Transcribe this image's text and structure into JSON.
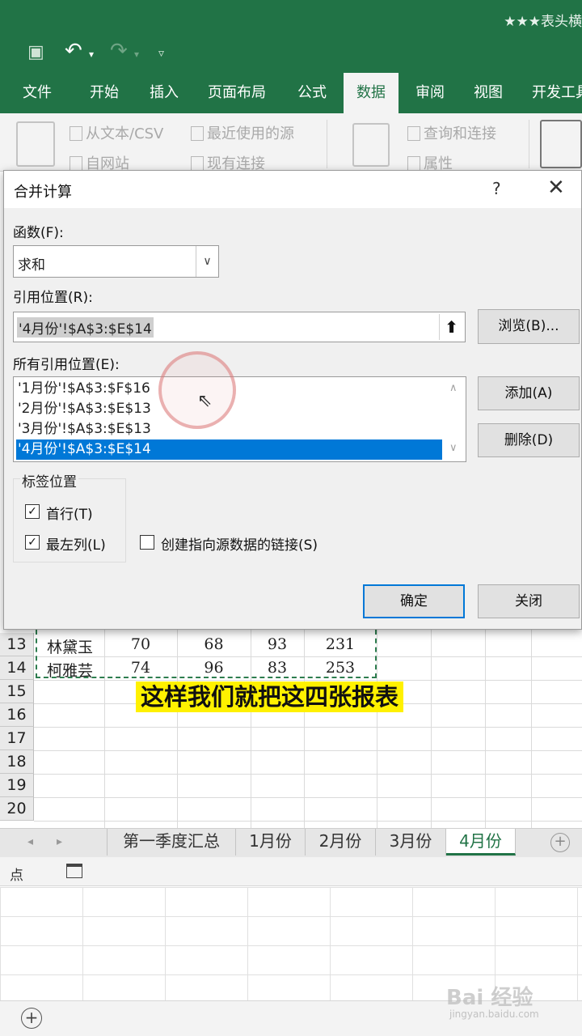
{
  "app": {
    "doc_title": "★★★表头横",
    "ribbon_tabs": [
      "文件",
      "开始",
      "插入",
      "页面布局",
      "公式",
      "数据",
      "审阅",
      "视图",
      "开发工具"
    ],
    "active_tab": "数据",
    "ribbon_items": {
      "from_text_csv": "从文本/CSV",
      "recent_sources": "最近使用的源",
      "from_web": "自网站",
      "existing_connections": "现有连接",
      "queries_connections": "查询和连接",
      "properties": "属性"
    }
  },
  "dialog": {
    "title": "合并计算",
    "help": "?",
    "close": "✕",
    "function_label": "函数(F):",
    "function_value": "求和",
    "reference_label": "引用位置(R):",
    "reference_value": "'4月份'!$A$3:$E$14",
    "browse_button": "浏览(B)...",
    "all_references_label": "所有引用位置(E):",
    "all_references": [
      "'1月份'!$A$3:$F$16",
      "'2月份'!$A$3:$E$13",
      "'3月份'!$A$3:$E$13",
      "'4月份'!$A$3:$E$14"
    ],
    "selected_reference_index": 3,
    "add_button": "添加(A)",
    "delete_button": "删除(D)",
    "labels_group": "标签位置",
    "top_row_label": "首行(T)",
    "top_row_checked": true,
    "left_column_label": "最左列(L)",
    "left_column_checked": true,
    "create_links_label": "创建指向源数据的链接(S)",
    "create_links_checked": false,
    "ok_button": "确定",
    "close_button": "关闭"
  },
  "sheet": {
    "rows": [
      {
        "num": "13",
        "cells": [
          "林黛玉",
          "70",
          "68",
          "93",
          "231"
        ]
      },
      {
        "num": "14",
        "cells": [
          "柯雅芸",
          "74",
          "96",
          "83",
          "253"
        ]
      },
      {
        "num": "15",
        "cells": []
      },
      {
        "num": "16",
        "cells": []
      },
      {
        "num": "17",
        "cells": []
      },
      {
        "num": "18",
        "cells": []
      },
      {
        "num": "19",
        "cells": []
      },
      {
        "num": "20",
        "cells": []
      }
    ],
    "subtitle": "这样我们就把这四张报表",
    "tabs": [
      "第一季度汇总",
      "1月份",
      "2月份",
      "3月份",
      "4月份"
    ],
    "active_sheet": "4月份",
    "status_text": "点"
  },
  "watermark": {
    "brand": "Bai 经验",
    "url": "jingyan.baidu.com"
  },
  "colors": {
    "excel_green": "#217346",
    "selection_blue": "#0078d7",
    "subtitle_bg": "#fff100"
  }
}
